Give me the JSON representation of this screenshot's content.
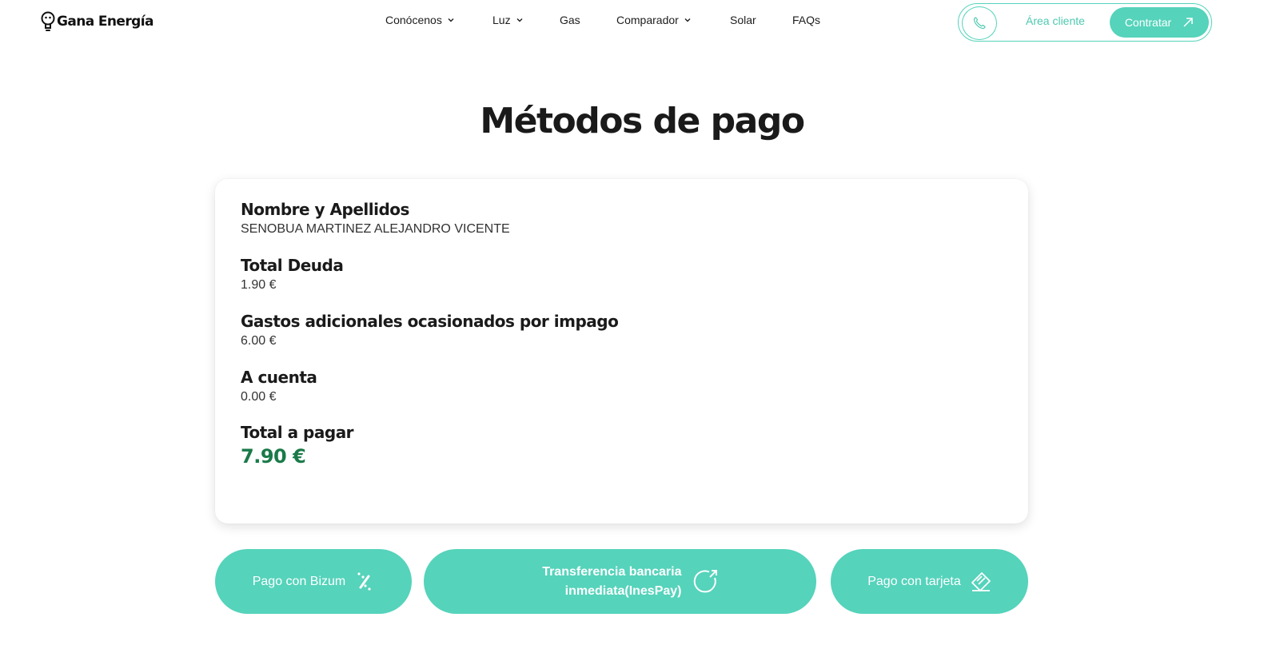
{
  "header": {
    "logo_text": "Gana Energía",
    "nav": [
      {
        "label": "Conócenos",
        "dropdown": true
      },
      {
        "label": "Luz",
        "dropdown": true
      },
      {
        "label": "Gas",
        "dropdown": false
      },
      {
        "label": "Comparador",
        "dropdown": true
      },
      {
        "label": "Solar",
        "dropdown": false
      },
      {
        "label": "FAQs",
        "dropdown": false
      }
    ],
    "area_cliente_label": "Área cliente",
    "contratar_label": "Contratar"
  },
  "page": {
    "title": "Métodos de pago"
  },
  "summary": {
    "name_label": "Nombre y Apellidos",
    "name_value": "SENOBUA MARTINEZ ALEJANDRO VICENTE",
    "debt_label": "Total Deuda",
    "debt_value": "1.90 €",
    "extra_label": "Gastos adicionales ocasionados por impago",
    "extra_value": "6.00 €",
    "account_label": "A cuenta",
    "account_value": "0.00 €",
    "total_label": "Total a pagar",
    "total_value": "7.90 €"
  },
  "payment_methods": {
    "bizum_label": "Pago con Bizum",
    "transfer_label_line1": "Transferencia bancaria",
    "transfer_label_line2": "inmediata(InesPay)",
    "card_label": "Pago con tarjeta"
  },
  "colors": {
    "accent": "#55d3bb",
    "accent_text": "#4ec9b0",
    "total_green": "#1a7a48",
    "text_dark": "#1a1a1a"
  },
  "icons": [
    "lightbulb-logo-icon",
    "chevron-down-icon",
    "phone-icon",
    "arrow-up-right-icon",
    "bizum-icon",
    "refresh-arrow-icon",
    "card-tag-icon"
  ]
}
